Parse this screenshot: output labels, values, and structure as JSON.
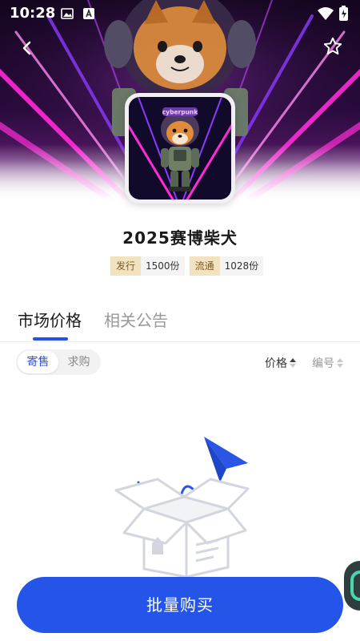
{
  "status_bar": {
    "time": "10:28"
  },
  "header": {
    "back_icon": "chevron-left-icon",
    "favorite_icon": "star-outline-icon"
  },
  "artwork": {
    "caption": "cyberpunk"
  },
  "product": {
    "title": "2025赛博柴犬",
    "tags": [
      {
        "label": "发行",
        "value": "1500份"
      },
      {
        "label": "流通",
        "value": "1028份"
      }
    ]
  },
  "tabs": [
    {
      "label": "市场价格",
      "active": true
    },
    {
      "label": "相关公告",
      "active": false
    }
  ],
  "filter": {
    "segment": [
      {
        "label": "寄售",
        "active": true
      },
      {
        "label": "求购",
        "active": false
      }
    ],
    "sort": [
      {
        "label": "价格",
        "active": true
      },
      {
        "label": "编号",
        "active": false
      }
    ]
  },
  "cta": {
    "label": "批量购买"
  },
  "colors": {
    "accent": "#2454e8",
    "tag_bg": "#f3e2bf",
    "neon_pink": "#ff2bd6",
    "neon_purple": "#8b3bff"
  }
}
